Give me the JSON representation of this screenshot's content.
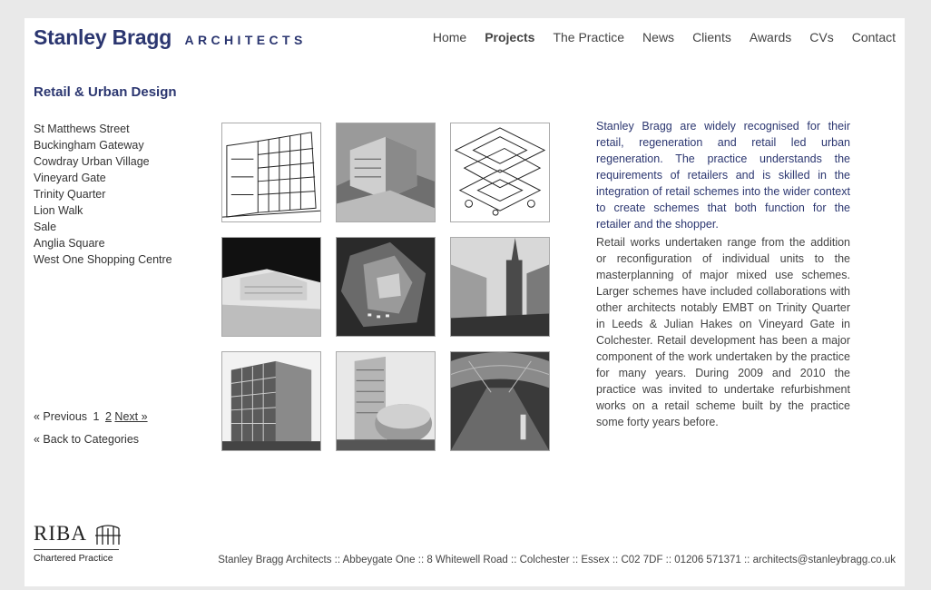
{
  "brand": {
    "name": "Stanley Bragg",
    "sub": "ARCHITECTS"
  },
  "nav": {
    "items": [
      {
        "label": "Home"
      },
      {
        "label": "Projects"
      },
      {
        "label": "The Practice"
      },
      {
        "label": "News"
      },
      {
        "label": "Clients"
      },
      {
        "label": "Awards"
      },
      {
        "label": "CVs"
      },
      {
        "label": "Contact"
      }
    ],
    "active": "Projects"
  },
  "section": {
    "title": "Retail & Urban Design"
  },
  "projects": [
    {
      "label": "St Matthews Street"
    },
    {
      "label": "Buckingham Gateway"
    },
    {
      "label": "Cowdray Urban Village"
    },
    {
      "label": "Vineyard Gate"
    },
    {
      "label": "Trinity Quarter"
    },
    {
      "label": "Lion Walk"
    },
    {
      "label": "Sale"
    },
    {
      "label": "Anglia Square"
    },
    {
      "label": "West One Shopping Centre"
    }
  ],
  "pager": {
    "prev": "« Previous",
    "current": "1",
    "page2": "2",
    "next": "Next »",
    "back": "« Back to Categories"
  },
  "intro": "Stanley Bragg are widely recognised for their retail, regeneration and retail led urban regeneration. The practice understands the requirements of retailers and is skilled in the integration of retail schemes into the wider context to create schemes that both function for the retailer and the shopper.",
  "body": "Retail works undertaken range from the addition or reconfiguration of individual units to the masterplanning of major mixed use schemes. Larger schemes have included collaborations with other architects notably EMBT on Trinity Quarter in Leeds & Julian Hakes on Vineyard Gate in Colchester. Retail development has been a major component of the work undertaken by the practice for many years. During 2009 and 2010 the practice was invited to undertake refurbishment works on a retail scheme built by the practice some forty years before.",
  "riba": {
    "word": "RIBA",
    "sub": "Chartered Practice"
  },
  "footer": "Stanley Bragg Architects :: Abbeygate One :: 8 Whitewell Road :: Colchester :: Essex :: C02 7DF :: 01206 571371 :: architects@stanleybragg.co.uk",
  "colors": {
    "brand": "#2b3670",
    "text": "#333333",
    "background": "#e9e9e9"
  }
}
